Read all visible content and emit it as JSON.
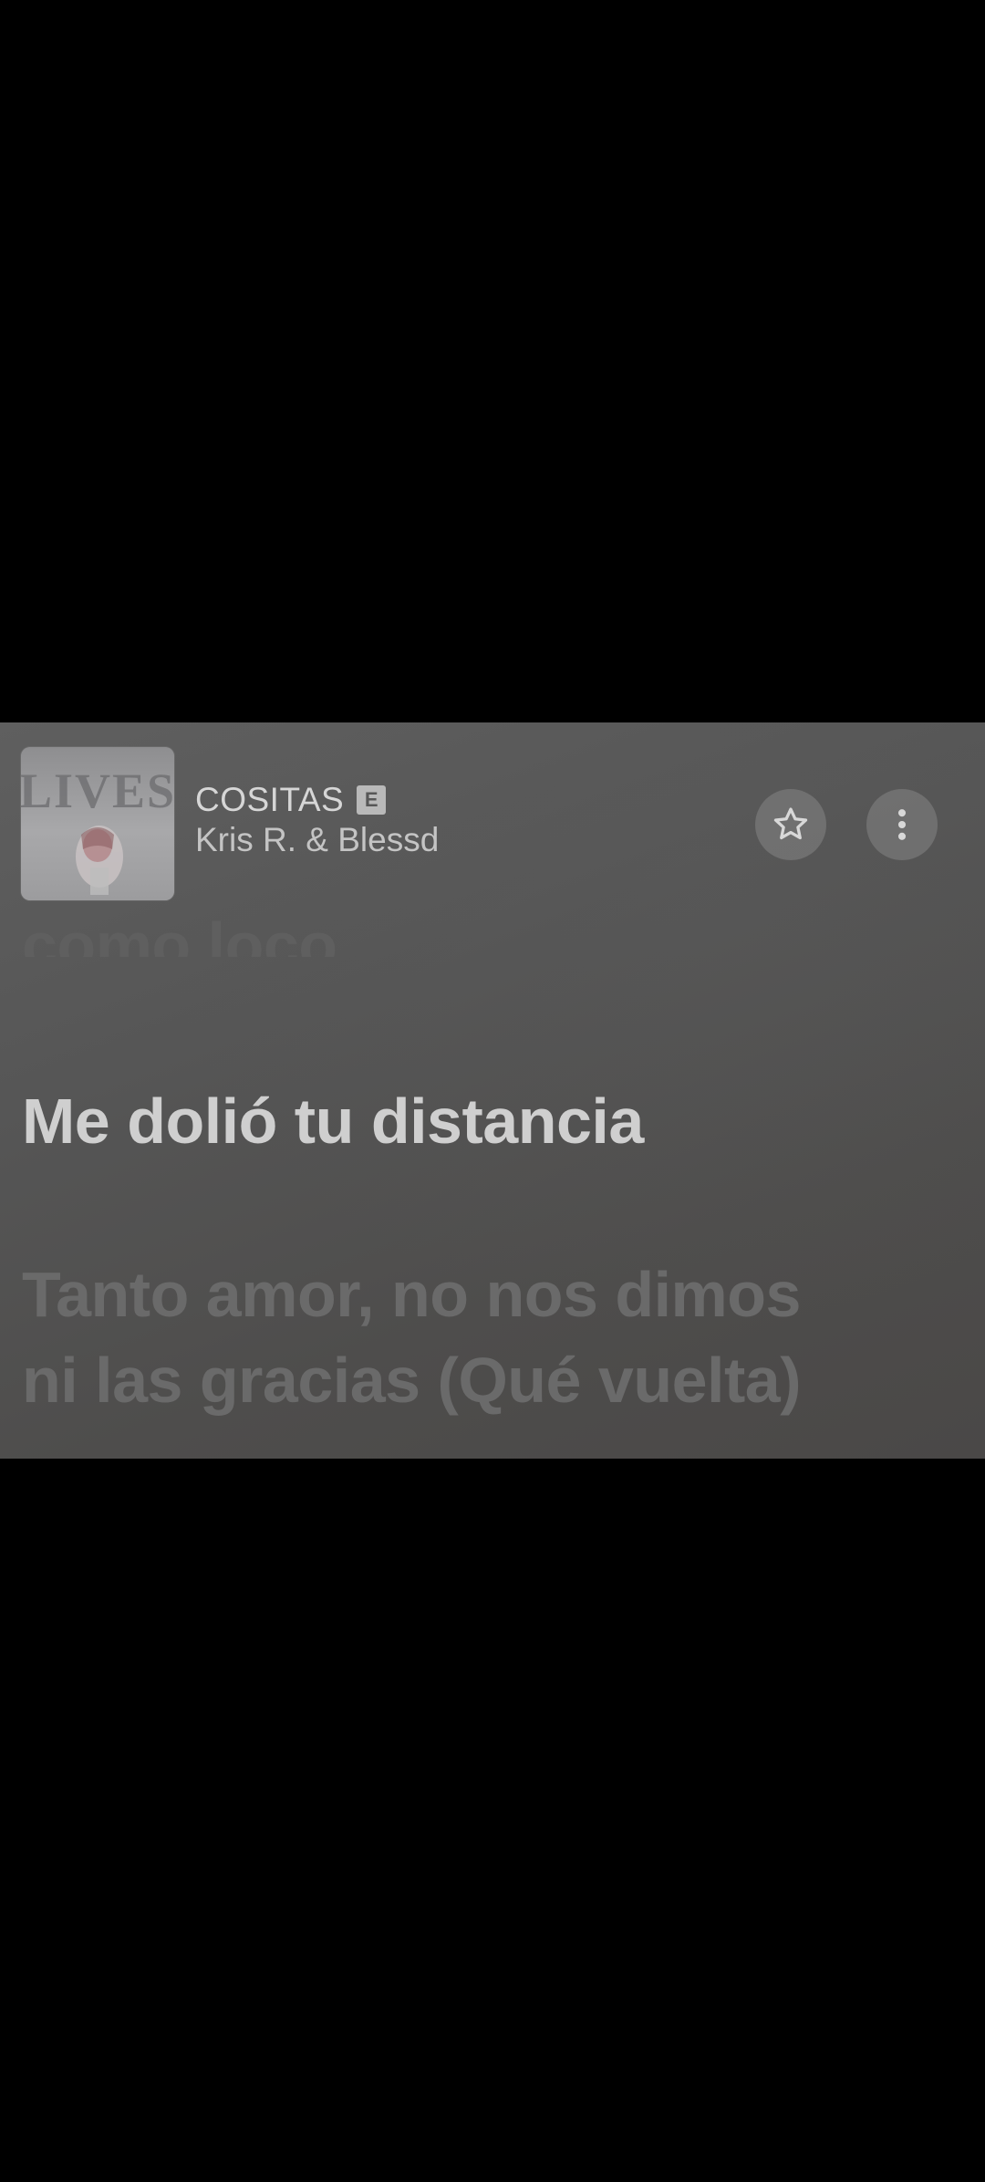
{
  "now_playing": {
    "title": "COSITAS",
    "explicit_badge": "E",
    "artist": "Kris R. & Blessd",
    "album_art_text": "LIVES"
  },
  "controls": {
    "favorite_icon": "star-outline-icon",
    "more_icon": "more-vertical-icon"
  },
  "lyrics": {
    "previous_line": "como loco",
    "current_line": "Me dolió tu distancia",
    "next_lines": [
      "Tanto amor, no nos dimos",
      "ni las gracias (Qué vuelta)"
    ]
  },
  "colors": {
    "panel_background": "#575757",
    "current_lyric": "#cfcfcf",
    "inactive_lyric": "#6a6a6a"
  }
}
